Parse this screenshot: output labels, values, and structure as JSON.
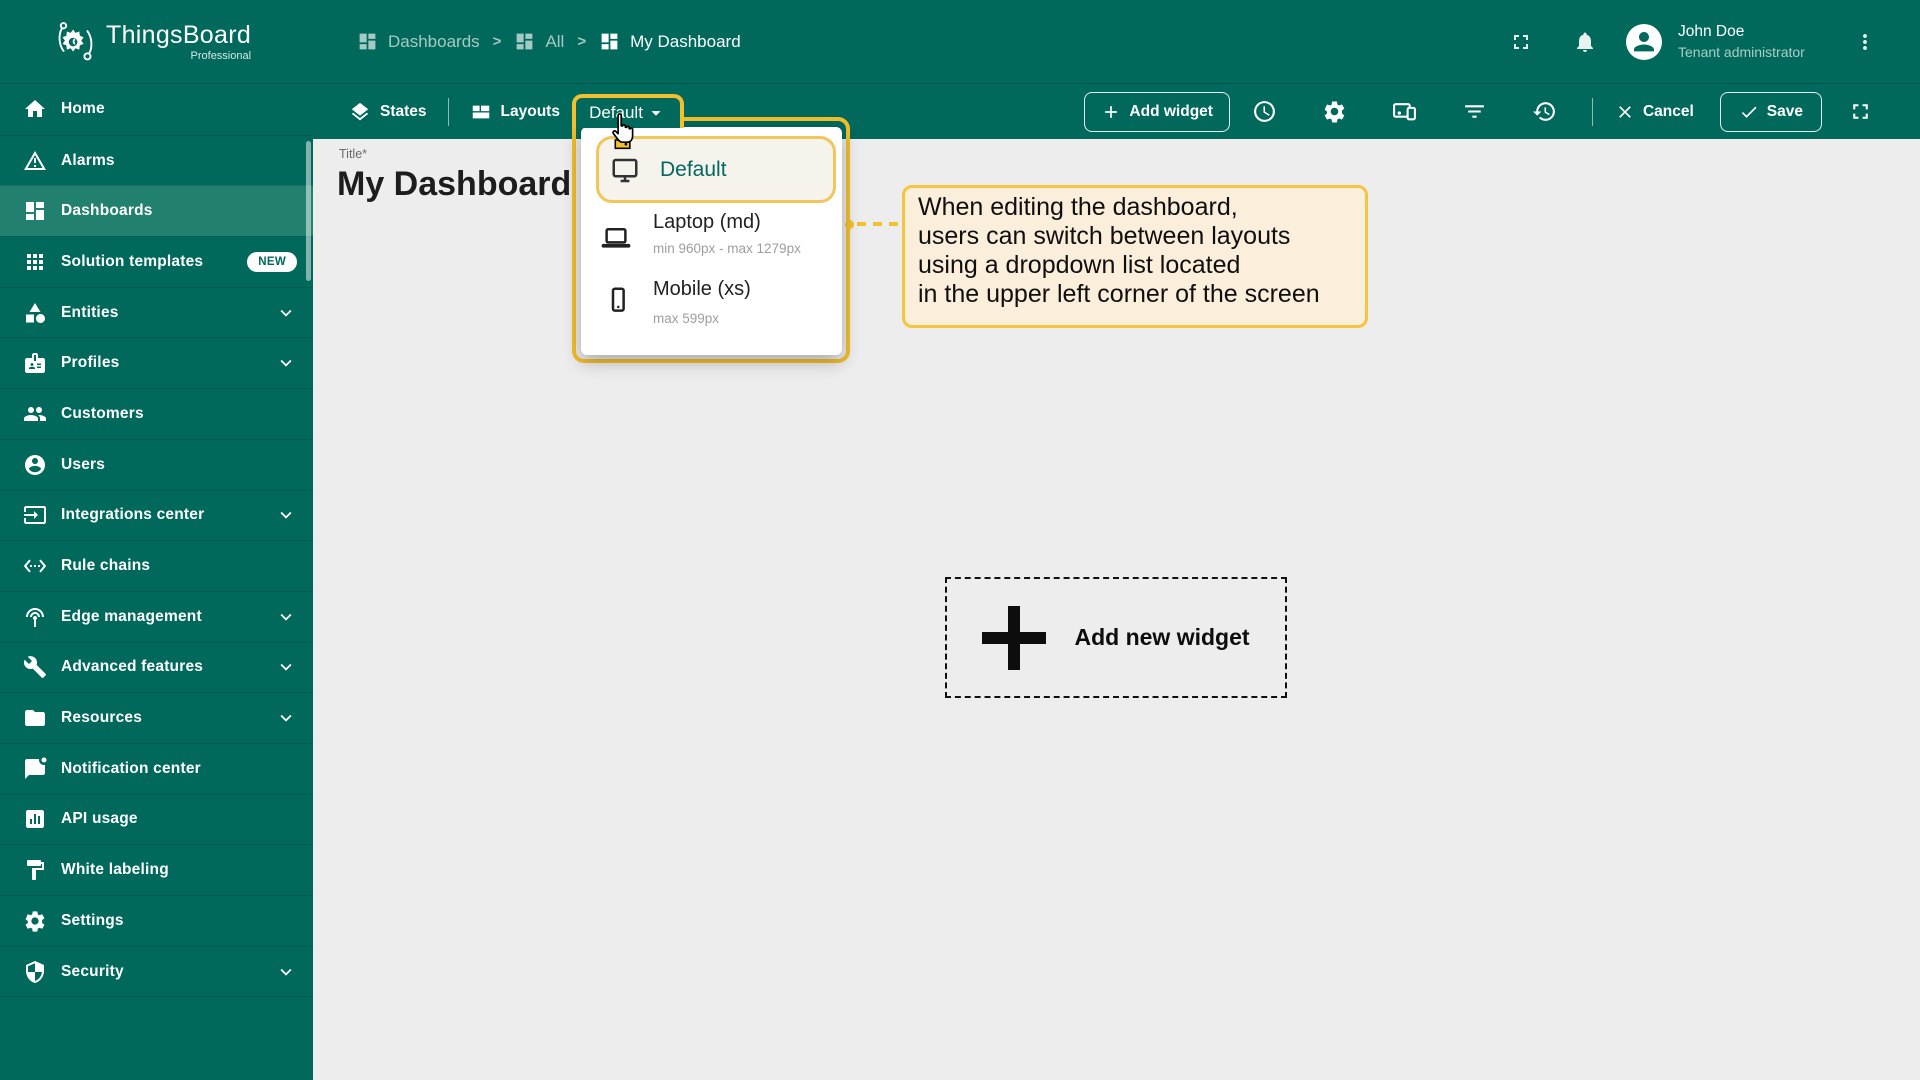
{
  "colors": {
    "primary_teal": "#00695c",
    "sidebar_active_bg": "#22806f",
    "accent_yellow": "#f2bf2e",
    "callout_bg": "#fbeeda",
    "content_bg": "#ededed"
  },
  "logo": {
    "title": "ThingsBoard",
    "subtitle": "Professional"
  },
  "breadcrumb": {
    "separator": ">",
    "items": [
      {
        "label": "Dashboards",
        "icon": "dashboard-icon"
      },
      {
        "label": "All",
        "icon": "dashboard-icon"
      },
      {
        "label": "My Dashboard",
        "icon": "dashboard-icon"
      }
    ]
  },
  "header": {
    "user_name": "John Doe",
    "user_role": "Tenant administrator",
    "icons": [
      "fullscreen-icon",
      "notifications-bell-icon",
      "avatar",
      "more-vert-icon"
    ]
  },
  "sidebar": {
    "items": [
      {
        "label": "Home",
        "icon": "home-icon"
      },
      {
        "label": "Alarms",
        "icon": "warning-icon"
      },
      {
        "label": "Dashboards",
        "icon": "dashboard-icon",
        "active": true
      },
      {
        "label": "Solution templates",
        "icon": "apps-grid-icon",
        "badge": "NEW"
      },
      {
        "label": "Entities",
        "icon": "category-icon",
        "expandable": true
      },
      {
        "label": "Profiles",
        "icon": "badge-icon",
        "expandable": true
      },
      {
        "label": "Customers",
        "icon": "people-icon"
      },
      {
        "label": "Users",
        "icon": "account-circle-icon"
      },
      {
        "label": "Integrations center",
        "icon": "input-icon",
        "expandable": true
      },
      {
        "label": "Rule chains",
        "icon": "ethernet-icon"
      },
      {
        "label": "Edge management",
        "icon": "wifi-tethering-icon",
        "expandable": true
      },
      {
        "label": "Advanced features",
        "icon": "build-icon",
        "expandable": true
      },
      {
        "label": "Resources",
        "icon": "folder-icon",
        "expandable": true
      },
      {
        "label": "Notification center",
        "icon": "chat-notification-icon"
      },
      {
        "label": "API usage",
        "icon": "analytics-icon"
      },
      {
        "label": "White labeling",
        "icon": "format-paint-icon"
      },
      {
        "label": "Settings",
        "icon": "gear-icon"
      },
      {
        "label": "Security",
        "icon": "shield-icon",
        "expandable": true
      }
    ]
  },
  "toolbar": {
    "states_label": "States",
    "layouts_label": "Layouts",
    "layout_selected": "Default",
    "add_widget_label": "Add widget",
    "cancel_label": "Cancel",
    "save_label": "Save",
    "icons": [
      "time-window-icon",
      "settings-gear-icon",
      "manage-layouts-icon",
      "filter-icon",
      "version-history-icon",
      "fullscreen-icon"
    ]
  },
  "dashboard": {
    "title_label": "Title*",
    "title_value": "My Dashboard",
    "add_widget_placeholder": "Add new widget"
  },
  "layout_dropdown": {
    "items": [
      {
        "title": "Default",
        "icon": "monitor-icon",
        "selected": true
      },
      {
        "title": "Laptop (md)",
        "subtitle": "min 960px - max 1279px",
        "icon": "laptop-icon"
      },
      {
        "title": "Mobile (xs)",
        "subtitle": "max 599px",
        "icon": "smartphone-icon"
      }
    ]
  },
  "callout": {
    "text": "When editing the dashboard,\nusers can switch between layouts\nusing a dropdown list located\nin the upper left corner of the screen"
  }
}
